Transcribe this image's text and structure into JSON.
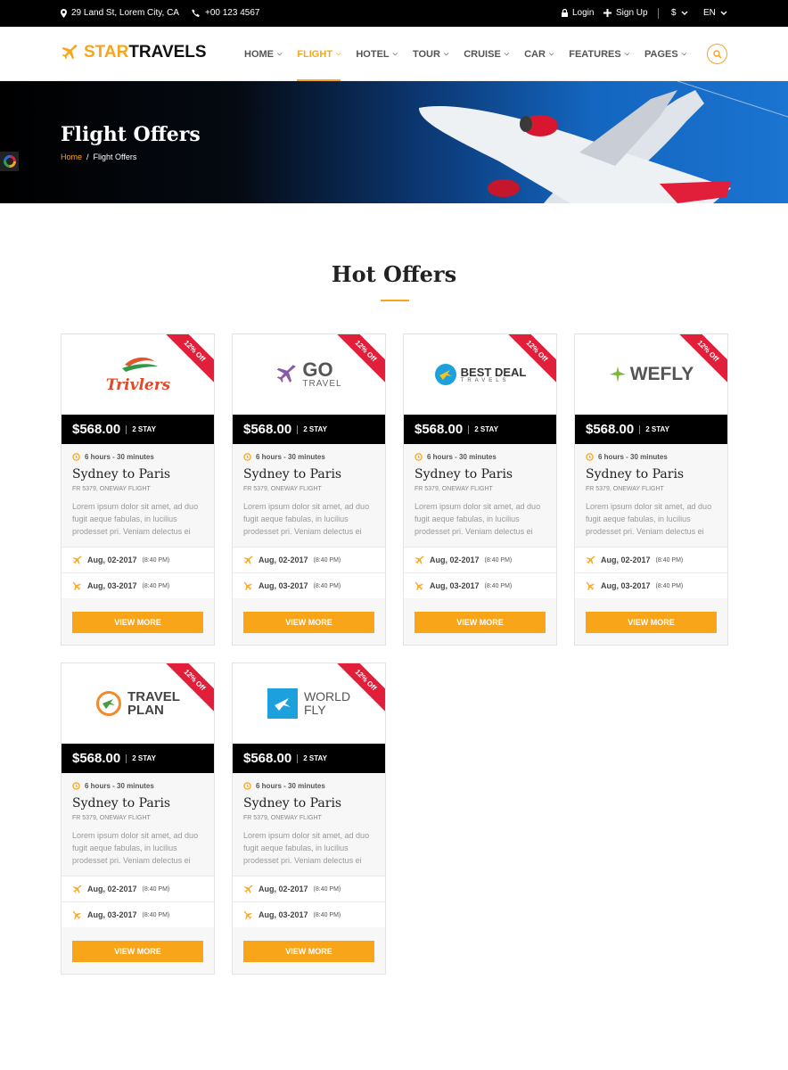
{
  "topbar": {
    "address": "29 Land St, Lorem City, CA",
    "phone": "+00 123 4567",
    "login": "Login",
    "signup": "Sign Up",
    "currency": "$",
    "language": "EN"
  },
  "brand": {
    "part1": "STAR",
    "part2": "TRAVELS"
  },
  "nav": [
    {
      "label": "HOME",
      "active": false
    },
    {
      "label": "FLIGHT",
      "active": true
    },
    {
      "label": "HOTEL",
      "active": false
    },
    {
      "label": "TOUR",
      "active": false
    },
    {
      "label": "CRUISE",
      "active": false
    },
    {
      "label": "CAR",
      "active": false
    },
    {
      "label": "FEATURES",
      "active": false
    },
    {
      "label": "PAGES",
      "active": false
    }
  ],
  "hero": {
    "title": "Flight Offers",
    "breadcrumb_home": "Home",
    "breadcrumb_sep": "/",
    "breadcrumb_current": "Flight Offers"
  },
  "section": {
    "title": "Hot Offers"
  },
  "cards": [
    {
      "brand": "Trivlers",
      "ribbon": "12% Off",
      "price": "$568.00",
      "stay": "2 STAY",
      "duration": "6 hours - 30 minutes",
      "route": "Sydney to Paris",
      "flight": "FR 5379,",
      "flight_type": "ONEWAY FLIGHT",
      "desc": "Lorem ipsum dolor sit amet, ad duo fugit aeque fabulas, in lucilius prodesset pri. Veniam delectus ei",
      "depart": "Aug, 02-2017",
      "depart_time": "(8:40 PM)",
      "arrive": "Aug, 03-2017",
      "arrive_time": "(8:40 PM)",
      "button": "VIEW MORE"
    },
    {
      "brand_line1": "GO",
      "brand_line2": "TRAVEL",
      "ribbon": "12% Off",
      "price": "$568.00",
      "stay": "2 STAY",
      "duration": "6 hours - 30 minutes",
      "route": "Sydney to Paris",
      "flight": "FR 5379,",
      "flight_type": "ONEWAY FLIGHT",
      "desc": "Lorem ipsum dolor sit amet, ad duo fugit aeque fabulas, in lucilius prodesset pri. Veniam delectus ei",
      "depart": "Aug, 02-2017",
      "depart_time": "(8:40 PM)",
      "arrive": "Aug, 03-2017",
      "arrive_time": "(8:40 PM)",
      "button": "VIEW MORE"
    },
    {
      "brand_line1": "BEST DEAL",
      "brand_line2": "TRAVELS",
      "ribbon": "12% Off",
      "price": "$568.00",
      "stay": "2 STAY",
      "duration": "6 hours - 30 minutes",
      "route": "Sydney to Paris",
      "flight": "FR 5379,",
      "flight_type": "ONEWAY FLIGHT",
      "desc": "Lorem ipsum dolor sit amet, ad duo fugit aeque fabulas, in lucilius prodesset pri. Veniam delectus ei",
      "depart": "Aug, 02-2017",
      "depart_time": "(8:40 PM)",
      "arrive": "Aug, 03-2017",
      "arrive_time": "(8:40 PM)",
      "button": "VIEW MORE"
    },
    {
      "brand_line1": "WE",
      "brand_line2": "FLY",
      "ribbon": "12% Off",
      "price": "$568.00",
      "stay": "2 STAY",
      "duration": "6 hours - 30 minutes",
      "route": "Sydney to Paris",
      "flight": "FR 5379,",
      "flight_type": "ONEWAY FLIGHT",
      "desc": "Lorem ipsum dolor sit amet, ad duo fugit aeque fabulas, in lucilius prodesset pri. Veniam delectus ei",
      "depart": "Aug, 02-2017",
      "depart_time": "(8:40 PM)",
      "arrive": "Aug, 03-2017",
      "arrive_time": "(8:40 PM)",
      "button": "VIEW MORE"
    },
    {
      "brand_line1": "TRAVEL",
      "brand_line2": "PLAN",
      "ribbon": "12% Off",
      "price": "$568.00",
      "stay": "2 STAY",
      "duration": "6 hours - 30 minutes",
      "route": "Sydney to Paris",
      "flight": "FR 5379,",
      "flight_type": "ONEWAY FLIGHT",
      "desc": "Lorem ipsum dolor sit amet, ad duo fugit aeque fabulas, in lucilius prodesset pri. Veniam delectus ei",
      "depart": "Aug, 02-2017",
      "depart_time": "(8:40 PM)",
      "arrive": "Aug, 03-2017",
      "arrive_time": "(8:40 PM)",
      "button": "VIEW MORE"
    },
    {
      "brand_line1": "WORLD",
      "brand_line2": "FLY",
      "ribbon": "12% Off",
      "price": "$568.00",
      "stay": "2 STAY",
      "duration": "6 hours - 30 minutes",
      "route": "Sydney to Paris",
      "flight": "FR 5379,",
      "flight_type": "ONEWAY FLIGHT",
      "desc": "Lorem ipsum dolor sit amet, ad duo fugit aeque fabulas, in lucilius prodesset pri. Veniam delectus ei",
      "depart": "Aug, 02-2017",
      "depart_time": "(8:40 PM)",
      "arrive": "Aug, 03-2017",
      "arrive_time": "(8:40 PM)",
      "button": "VIEW MORE"
    }
  ],
  "colors": {
    "accent": "#f9a51a",
    "ribbon": "#e21f3b",
    "dark": "#000000"
  },
  "icons": [
    "location-icon",
    "phone-icon",
    "lock-icon",
    "plus-icon",
    "plane-logo-icon",
    "search-icon",
    "clock-icon",
    "departure-icon",
    "arrival-icon"
  ]
}
